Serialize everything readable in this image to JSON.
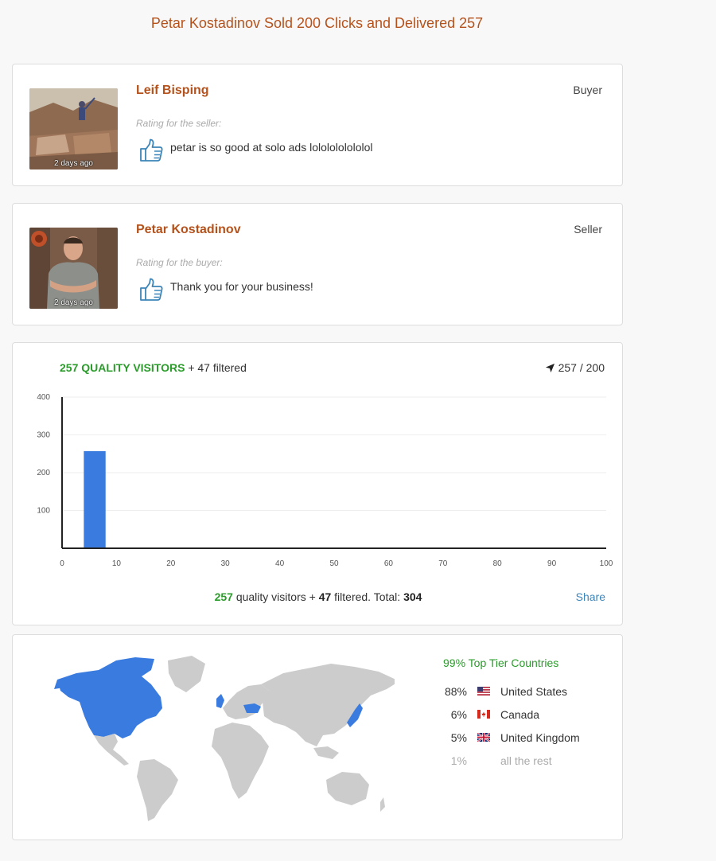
{
  "page_title": "Petar Kostadinov Sold 200 Clicks and Delivered 257",
  "reviews": [
    {
      "name": "Leif Bisping",
      "role": "Buyer",
      "rating_label": "Rating for the seller:",
      "text": "petar is so good at solo ads lololololololol",
      "time": "2 days ago",
      "icon": "thumbs-up-icon"
    },
    {
      "name": "Petar Kostadinov",
      "role": "Seller",
      "rating_label": "Rating for the buyer:",
      "text": "Thank you for your business!",
      "time": "2 days ago",
      "icon": "thumbs-up-icon"
    }
  ],
  "visitors": {
    "quality_label": "257 QUALITY VISITORS",
    "filtered_label": "+ 47 filtered",
    "ratio": "257 / 200",
    "ratio_icon": "location-arrow-icon",
    "summary": {
      "quality": "257",
      "quality_text": "quality visitors +",
      "filtered": "47",
      "filtered_text": "filtered. Total:",
      "total": "304"
    },
    "share": "Share"
  },
  "chart_data": {
    "type": "bar",
    "x": [
      6
    ],
    "values": [
      257
    ],
    "xlim": [
      0,
      100
    ],
    "ylim": [
      0,
      400
    ],
    "xticks": [
      0,
      10,
      20,
      30,
      40,
      50,
      60,
      70,
      80,
      90,
      100
    ],
    "yticks": [
      100,
      200,
      300,
      400
    ],
    "bar_width": 4,
    "bar_color": "#3a7be0",
    "grid": true
  },
  "geo": {
    "tier_label": "99% Top Tier Countries",
    "highlight_color": "#3a7be0",
    "base_color": "#cccccc",
    "countries": [
      {
        "pct": "88%",
        "name": "United States",
        "flag": "us-flag-icon"
      },
      {
        "pct": "6%",
        "name": "Canada",
        "flag": "ca-flag-icon"
      },
      {
        "pct": "5%",
        "name": "United Kingdom",
        "flag": "uk-flag-icon"
      }
    ],
    "rest": {
      "pct": "1%",
      "name": "all the rest"
    }
  },
  "colors": {
    "accent": "#b5521c",
    "green": "#2b9c2b",
    "link": "#3d85b8"
  }
}
